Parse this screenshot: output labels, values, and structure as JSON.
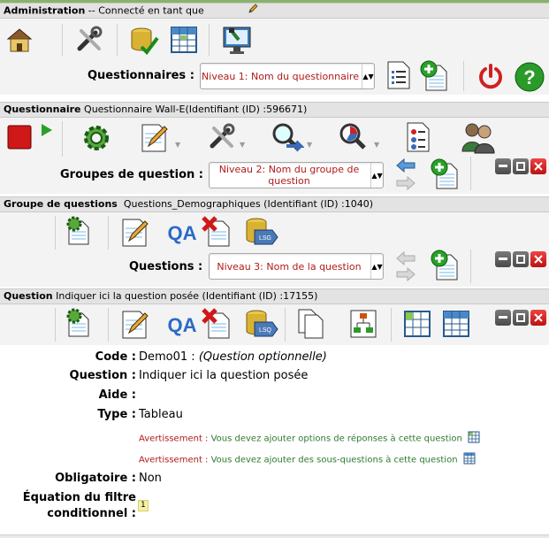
{
  "colors": {
    "accent_red": "#b01a1a",
    "accent_green": "#2f7a2f",
    "bar_bg": "#e3e3e3",
    "panel_bg": "#f3f3f3"
  },
  "admin": {
    "title": "Administration",
    "connected": "-- Connecté en tant que",
    "questionnaires_label": "Questionnaires :",
    "survey_select": "Niveau 1: Nom du questionnaire"
  },
  "survey": {
    "title": "Questionnaire",
    "info": "Questionnaire Wall-E(Identifiant (ID) :596671)",
    "groups_label": "Groupes de question :",
    "group_select": "Niveau 2: Nom du groupe de question"
  },
  "group": {
    "title": "Groupe de questions",
    "info": "Questions_Demographiques (Identifiant (ID) :1040)",
    "questions_label": "Questions :",
    "question_select": "Niveau 3: Nom de la question"
  },
  "question": {
    "title": "Question",
    "info": "Indiquer ici la question posée (Identifiant (ID) :17155)",
    "fields": {
      "code_label": "Code :",
      "code_value": "Demo01 :",
      "code_optional": "(Question optionnelle)",
      "question_label": "Question :",
      "question_value": "Indiquer ici la question posée",
      "help_label": "Aide :",
      "type_label": "Type :",
      "type_value": "Tableau",
      "warn_prefix": "Avertissement :",
      "warn1_text": "Vous devez ajouter options de réponses à cette question",
      "warn2_text": "Vous devez ajouter des sous-questions à cette question",
      "mandatory_label": "Obligatoire :",
      "mandatory_value": "Non",
      "relevance_label_1": "Équation du filtre",
      "relevance_label_2": "conditionnel :",
      "relevance_value": "1"
    }
  },
  "icons": {
    "qa_text": "QA",
    "lsg_text": "LSQ"
  }
}
